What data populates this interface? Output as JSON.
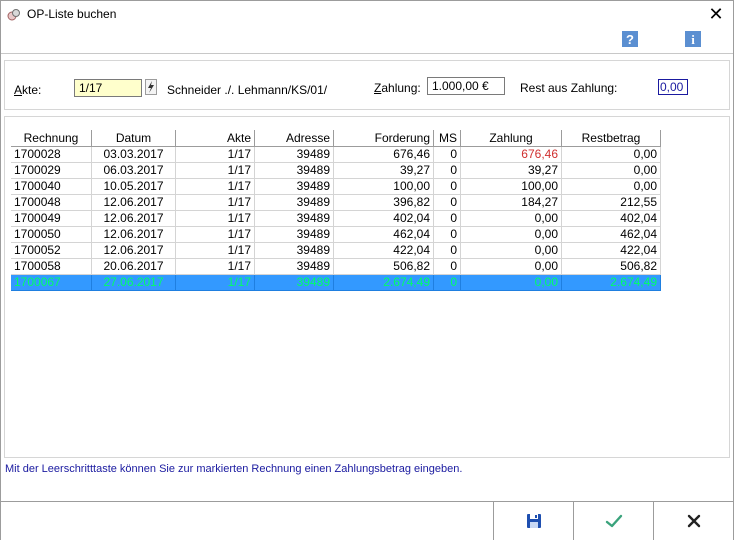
{
  "window": {
    "title": "OP-Liste buchen"
  },
  "header": {
    "akte_label": "Akte:",
    "akte_value": "1/17",
    "akte_name": "Schneider ./. Lehmann/KS/01/",
    "zahlung_label": "Zahlung:",
    "zahlung_value": "1.000,00 €",
    "rest_label": "Rest aus Zahlung:",
    "rest_value": "0,00"
  },
  "table": {
    "columns": [
      "Rechnung",
      "Datum",
      "Akte",
      "Adresse",
      "Forderung",
      "MS",
      "Zahlung",
      "Restbetrag"
    ],
    "rows": [
      [
        "1700028",
        "03.03.2017",
        "1/17",
        "39489",
        "676,46",
        "0",
        "676,46",
        "0,00"
      ],
      [
        "1700029",
        "06.03.2017",
        "1/17",
        "39489",
        "39,27",
        "0",
        "39,27",
        "0,00"
      ],
      [
        "1700040",
        "10.05.2017",
        "1/17",
        "39489",
        "100,00",
        "0",
        "100,00",
        "0,00"
      ],
      [
        "1700048",
        "12.06.2017",
        "1/17",
        "39489",
        "396,82",
        "0",
        "184,27",
        "212,55"
      ],
      [
        "1700049",
        "12.06.2017",
        "1/17",
        "39489",
        "402,04",
        "0",
        "0,00",
        "402,04"
      ],
      [
        "1700050",
        "12.06.2017",
        "1/17",
        "39489",
        "462,04",
        "0",
        "0,00",
        "462,04"
      ],
      [
        "1700052",
        "12.06.2017",
        "1/17",
        "39489",
        "422,04",
        "0",
        "0,00",
        "422,04"
      ],
      [
        "1700058",
        "20.06.2017",
        "1/17",
        "39489",
        "506,82",
        "0",
        "0,00",
        "506,82"
      ],
      [
        "1700067",
        "27.06.2017",
        "1/17",
        "39489",
        "2.674,49",
        "0",
        "0,00",
        "2.674,49"
      ]
    ],
    "selected_row": 8,
    "red_cell": {
      "row": 0,
      "col": 6
    }
  },
  "hint": "Mit der Leerschritttaste können Sie zur markierten Rechnung einen Zahlungsbetrag eingeben.",
  "icons": {
    "help": "help-icon",
    "info": "info-icon",
    "save": "save-icon",
    "ok": "checkmark-icon",
    "cancel": "cancel-icon"
  },
  "colors": {
    "selection": "#3399ff",
    "selection_text": "#00ff66",
    "red": "#d03030",
    "hint": "#1a1aa0"
  }
}
